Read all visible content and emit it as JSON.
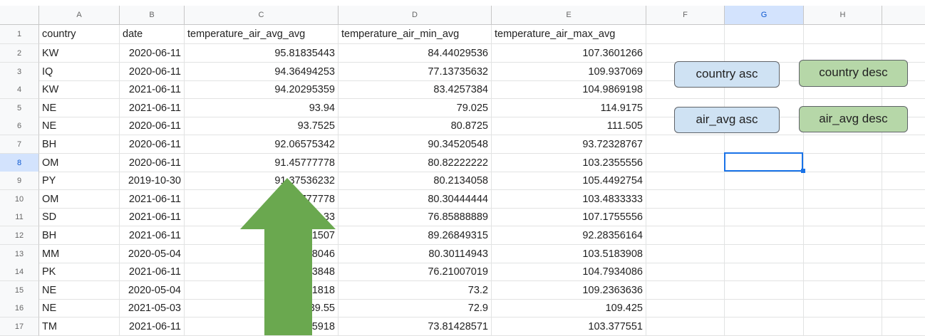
{
  "columns": [
    "A",
    "B",
    "C",
    "D",
    "E",
    "F",
    "G",
    "H"
  ],
  "selected_column": "G",
  "selected_row": "8",
  "header_row": [
    "country",
    "date",
    "temperature_air_avg_avg",
    "temperature_air_min_avg",
    "temperature_air_max_avg"
  ],
  "rows": [
    {
      "num": "2",
      "A": "KW",
      "B": "2020-06-11",
      "C": "95.81835443",
      "D": "84.44029536",
      "E": "107.3601266"
    },
    {
      "num": "3",
      "A": "IQ",
      "B": "2020-06-11",
      "C": "94.36494253",
      "D": "77.13735632",
      "E": "109.937069"
    },
    {
      "num": "4",
      "A": "KW",
      "B": "2021-06-11",
      "C": "94.20295359",
      "D": "83.4257384",
      "E": "104.9869198"
    },
    {
      "num": "5",
      "A": "NE",
      "B": "2021-06-11",
      "C": "93.94",
      "D": "79.025",
      "E": "114.9175"
    },
    {
      "num": "6",
      "A": "NE",
      "B": "2020-06-11",
      "C": "93.7525",
      "D": "80.8725",
      "E": "111.505"
    },
    {
      "num": "7",
      "A": "BH",
      "B": "2020-06-11",
      "C": "92.06575342",
      "D": "90.34520548",
      "E": "93.72328767"
    },
    {
      "num": "8",
      "A": "OM",
      "B": "2020-06-11",
      "C": "91.45777778",
      "D": "80.82222222",
      "E": "103.2355556"
    },
    {
      "num": "9",
      "A": "PY",
      "B": "2019-10-30",
      "C": "91.37536232",
      "D": "80.2134058",
      "E": "105.4492754"
    },
    {
      "num": "10",
      "A": "OM",
      "B": "2021-06-11",
      "C": "777778",
      "D": "80.30444444",
      "E": "103.4833333"
    },
    {
      "num": "11",
      "A": "SD",
      "B": "2021-06-11",
      "C": "33",
      "D": "76.85888889",
      "E": "107.1755556"
    },
    {
      "num": "12",
      "A": "BH",
      "B": "2021-06-11",
      "C": "1507",
      "D": "89.26849315",
      "E": "92.28356164"
    },
    {
      "num": "13",
      "A": "MM",
      "B": "2020-05-04",
      "C": "8046",
      "D": "80.30114943",
      "E": "103.5183908"
    },
    {
      "num": "14",
      "A": "PK",
      "B": "2021-06-11",
      "C": "3848",
      "D": "76.21007019",
      "E": "104.7934086"
    },
    {
      "num": "15",
      "A": "NE",
      "B": "2020-05-04",
      "C": "1818",
      "D": "73.2",
      "E": "109.2363636"
    },
    {
      "num": "16",
      "A": "NE",
      "B": "2021-05-03",
      "C": "39.55",
      "D": "72.9",
      "E": "109.425"
    },
    {
      "num": "17",
      "A": "TM",
      "B": "2021-06-11",
      "C": "5918",
      "D": "73.81428571",
      "E": "103.377551"
    }
  ],
  "buttons": {
    "country_asc": "country asc",
    "country_desc": "country desc",
    "air_avg_asc": "air_avg asc",
    "air_avg_desc": "air_avg desc"
  },
  "colors": {
    "button_blue": "#cfe2f3",
    "button_green": "#b6d7a8",
    "arrow_green": "#6aa84f",
    "selection_blue": "#1a73e8"
  },
  "overlay_icon": "up-arrow-icon"
}
